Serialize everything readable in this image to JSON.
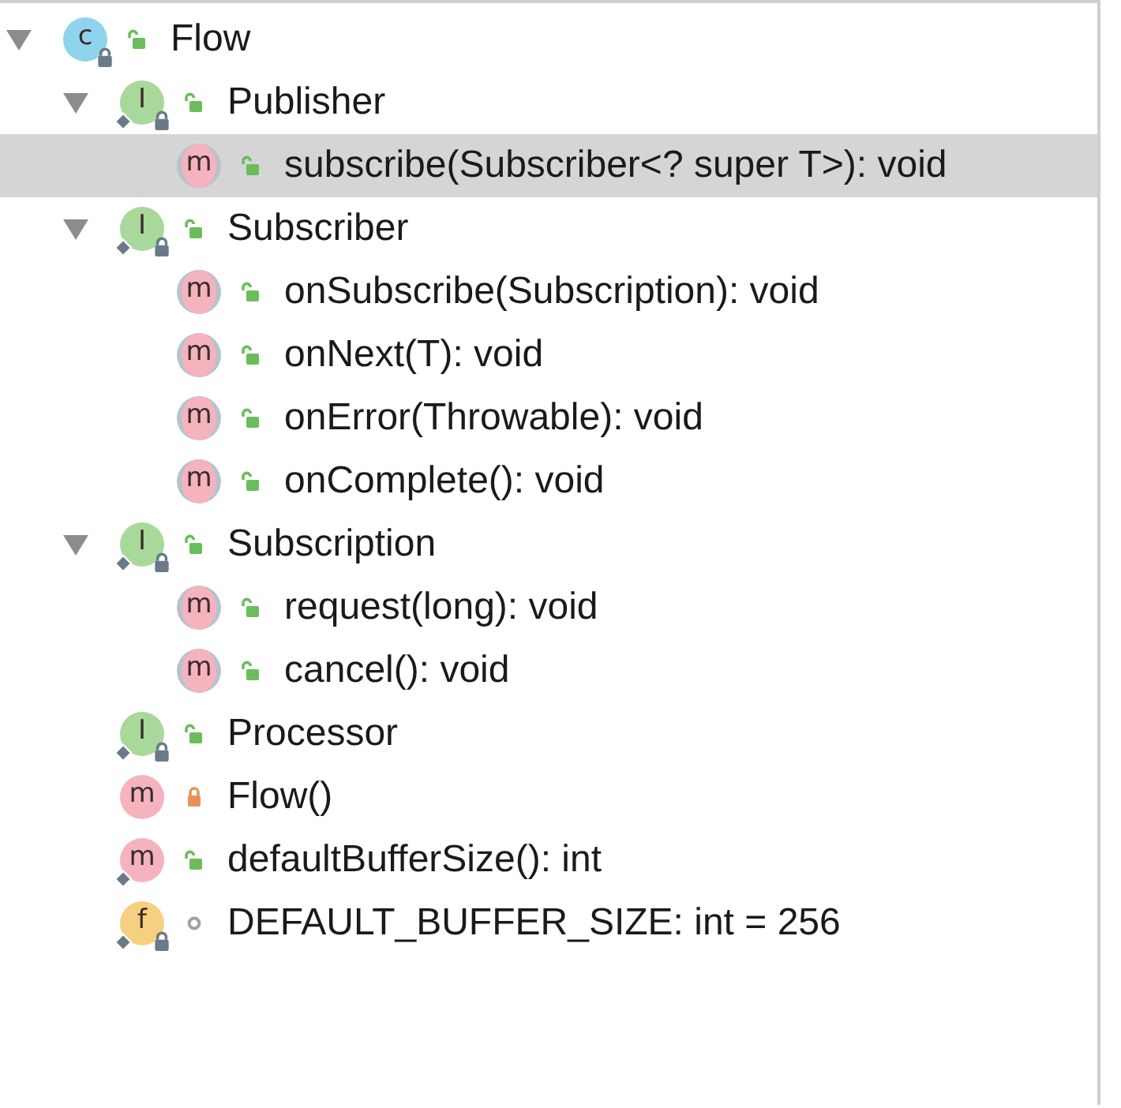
{
  "tree": [
    {
      "name": "Flow",
      "letter": "c",
      "kind": "class",
      "private": false,
      "package_private": false,
      "final": true,
      "static": false,
      "abstract": false,
      "expanded": true,
      "selected": false,
      "children": [
        {
          "name": "Publisher",
          "letter": "I",
          "kind": "interface",
          "private": false,
          "package_private": false,
          "final": true,
          "static": true,
          "abstract": false,
          "expanded": true,
          "selected": false,
          "children": [
            {
              "name": "subscribe(Subscriber<? super T>): void",
              "letter": "m",
              "kind": "method",
              "private": false,
              "package_private": false,
              "final": false,
              "static": false,
              "abstract": true,
              "selected": true
            }
          ]
        },
        {
          "name": "Subscriber",
          "letter": "I",
          "kind": "interface",
          "private": false,
          "package_private": false,
          "final": true,
          "static": true,
          "abstract": false,
          "expanded": true,
          "selected": false,
          "children": [
            {
              "name": "onSubscribe(Subscription): void",
              "letter": "m",
              "kind": "method",
              "private": false,
              "package_private": false,
              "final": false,
              "static": false,
              "abstract": true,
              "selected": false
            },
            {
              "name": "onNext(T): void",
              "letter": "m",
              "kind": "method",
              "private": false,
              "package_private": false,
              "final": false,
              "static": false,
              "abstract": true,
              "selected": false
            },
            {
              "name": "onError(Throwable): void",
              "letter": "m",
              "kind": "method",
              "private": false,
              "package_private": false,
              "final": false,
              "static": false,
              "abstract": true,
              "selected": false
            },
            {
              "name": "onComplete(): void",
              "letter": "m",
              "kind": "method",
              "private": false,
              "package_private": false,
              "final": false,
              "static": false,
              "abstract": true,
              "selected": false
            }
          ]
        },
        {
          "name": "Subscription",
          "letter": "I",
          "kind": "interface",
          "private": false,
          "package_private": false,
          "final": true,
          "static": true,
          "abstract": false,
          "expanded": true,
          "selected": false,
          "children": [
            {
              "name": "request(long): void",
              "letter": "m",
              "kind": "method",
              "private": false,
              "package_private": false,
              "final": false,
              "static": false,
              "abstract": true,
              "selected": false
            },
            {
              "name": "cancel(): void",
              "letter": "m",
              "kind": "method",
              "private": false,
              "package_private": false,
              "final": false,
              "static": false,
              "abstract": true,
              "selected": false
            }
          ]
        },
        {
          "name": "Processor",
          "letter": "I",
          "kind": "interface",
          "private": false,
          "package_private": false,
          "final": true,
          "static": true,
          "abstract": false,
          "selected": false
        },
        {
          "name": "Flow()",
          "letter": "m",
          "kind": "method",
          "private": true,
          "package_private": false,
          "final": false,
          "static": false,
          "abstract": false,
          "selected": false
        },
        {
          "name": "defaultBufferSize(): int",
          "letter": "m",
          "kind": "method",
          "private": false,
          "package_private": false,
          "final": false,
          "static": true,
          "abstract": false,
          "selected": false
        },
        {
          "name": "DEFAULT_BUFFER_SIZE: int = 256",
          "letter": "f",
          "kind": "field",
          "private": false,
          "package_private": true,
          "final": true,
          "static": true,
          "abstract": false,
          "selected": false
        }
      ]
    }
  ]
}
